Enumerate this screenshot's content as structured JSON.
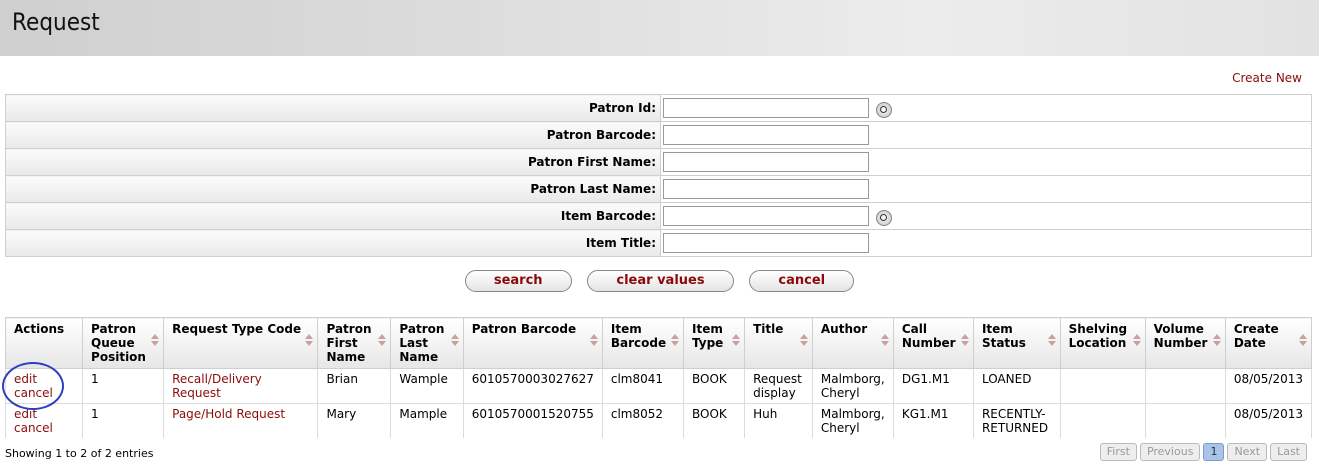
{
  "page": {
    "title": "Request",
    "create_new": "Create New"
  },
  "criteria": [
    {
      "label": "Patron Id:",
      "value": "",
      "lookup": true
    },
    {
      "label": "Patron Barcode:",
      "value": "",
      "lookup": false
    },
    {
      "label": "Patron First Name:",
      "value": "",
      "lookup": false
    },
    {
      "label": "Patron Last Name:",
      "value": "",
      "lookup": false
    },
    {
      "label": "Item Barcode:",
      "value": "",
      "lookup": true
    },
    {
      "label": "Item Title:",
      "value": "",
      "lookup": false
    }
  ],
  "buttons": {
    "search": "search",
    "clear": "clear values",
    "cancel": "cancel"
  },
  "results": {
    "headers": [
      "Actions",
      "Patron Queue Position",
      "Request Type Code",
      "Patron First Name",
      "Patron Last Name",
      "Patron Barcode",
      "Item Barcode",
      "Item Type",
      "Title",
      "Author",
      "Call Number",
      "Item Status",
      "Shelving Location",
      "Volume Number",
      "Create Date"
    ],
    "rows": [
      {
        "actions": [
          "edit",
          "cancel"
        ],
        "queue": "1",
        "type": "Recall/Delivery Request",
        "first": "Brian",
        "last": "Wample",
        "patron_barcode": "6010570003027627",
        "item_barcode": "clm8041",
        "item_type": "BOOK",
        "title": "Request display",
        "author": "Malmborg, Cheryl",
        "call_number": "DG1.M1",
        "status": "LOANED",
        "shelving": "",
        "volume": "",
        "date": "08/05/2013"
      },
      {
        "actions": [
          "edit",
          "cancel"
        ],
        "queue": "1",
        "type": "Page/Hold Request",
        "first": "Mary",
        "last": "Mample",
        "patron_barcode": "6010570001520755",
        "item_barcode": "clm8052",
        "item_type": "BOOK",
        "title": "Huh",
        "author": "Malmborg, Cheryl",
        "call_number": "KG1.M1",
        "status": "RECENTLY-RETURNED",
        "shelving": "",
        "volume": "",
        "date": "08/05/2013"
      }
    ]
  },
  "footer": {
    "info": "Showing 1 to 2 of 2 entries",
    "pager": {
      "first": "First",
      "previous": "Previous",
      "page": "1",
      "next": "Next",
      "last": "Last"
    }
  },
  "annotation_color": "#2d3fbf"
}
